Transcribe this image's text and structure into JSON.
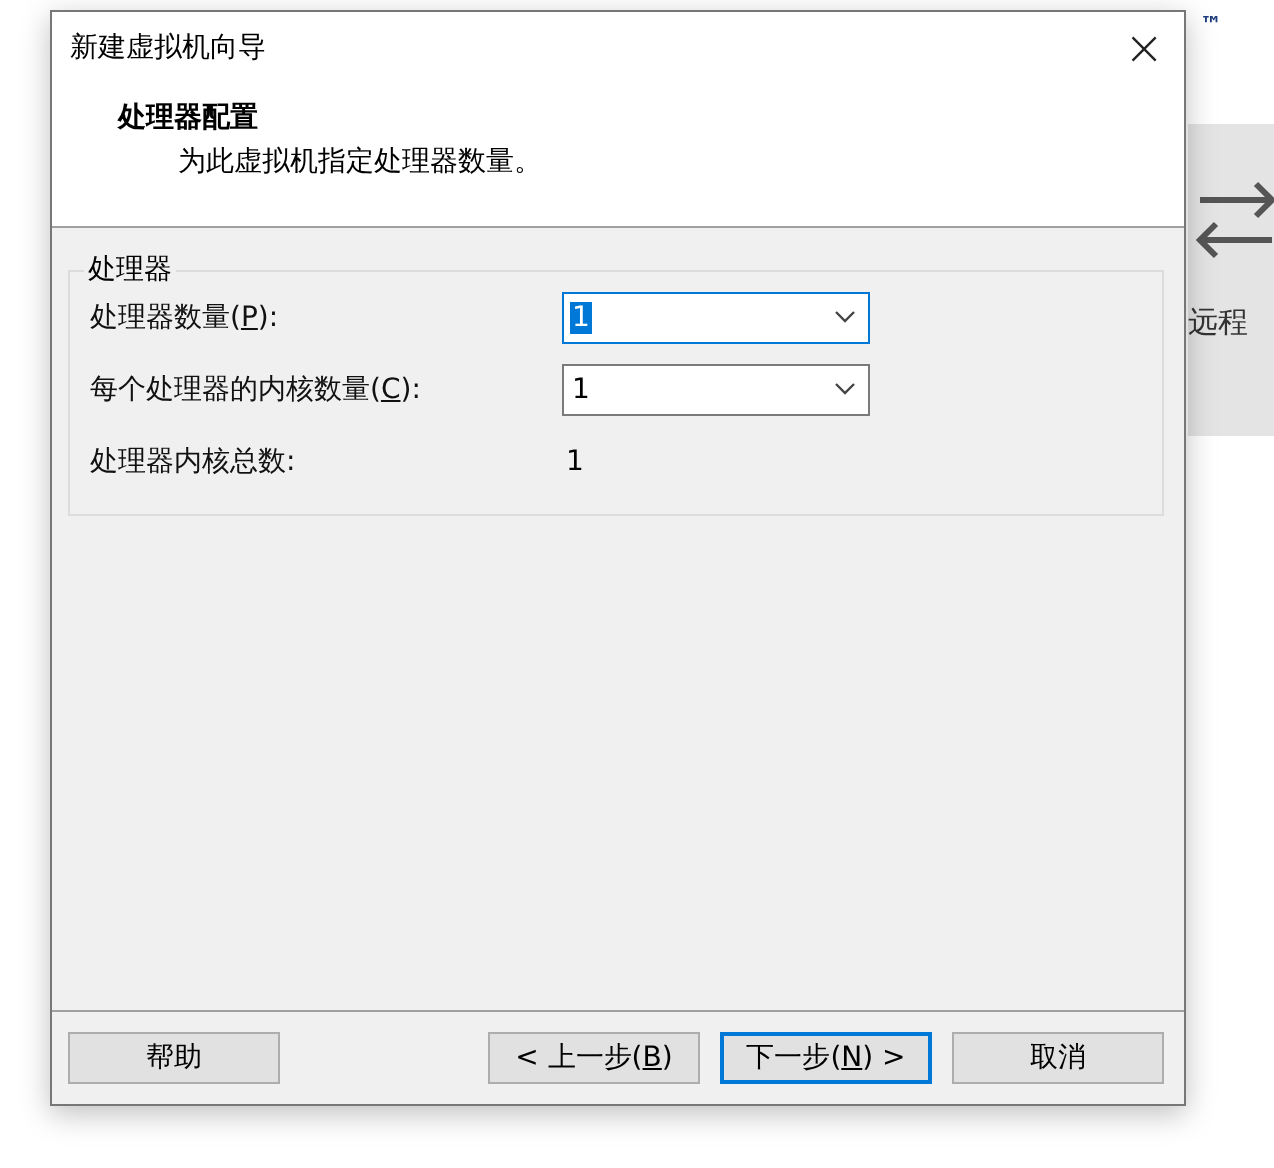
{
  "background_app": {
    "trademark": "™",
    "panel_label": "远程"
  },
  "window": {
    "title": "新建虚拟机向导",
    "close_glyph": "×"
  },
  "header": {
    "title": "处理器配置",
    "subtitle": "为此虚拟机指定处理器数量。"
  },
  "group": {
    "title": "处理器",
    "rows": [
      {
        "kind": "combo",
        "label_before": "处理器数量(",
        "mnemonic": "P",
        "label_after": "):",
        "value": "1",
        "focused": true
      },
      {
        "kind": "combo",
        "label_before": "每个处理器的内核数量(",
        "mnemonic": "C",
        "label_after": "):",
        "value": "1",
        "focused": false
      },
      {
        "kind": "readout",
        "label_before": "处理器内核总数:",
        "value": "1"
      }
    ]
  },
  "buttons": [
    {
      "label_before": "帮助",
      "default": false,
      "kind": "aside"
    },
    {
      "label_before": "< 上一步(",
      "mnemonic": "B",
      "label_after": ")",
      "default": false,
      "kind": "action"
    },
    {
      "label_before": "下一步(",
      "mnemonic": "N",
      "label_after": ") >",
      "default": true,
      "kind": "action"
    },
    {
      "label_before": "取消",
      "default": false,
      "kind": "action"
    }
  ]
}
